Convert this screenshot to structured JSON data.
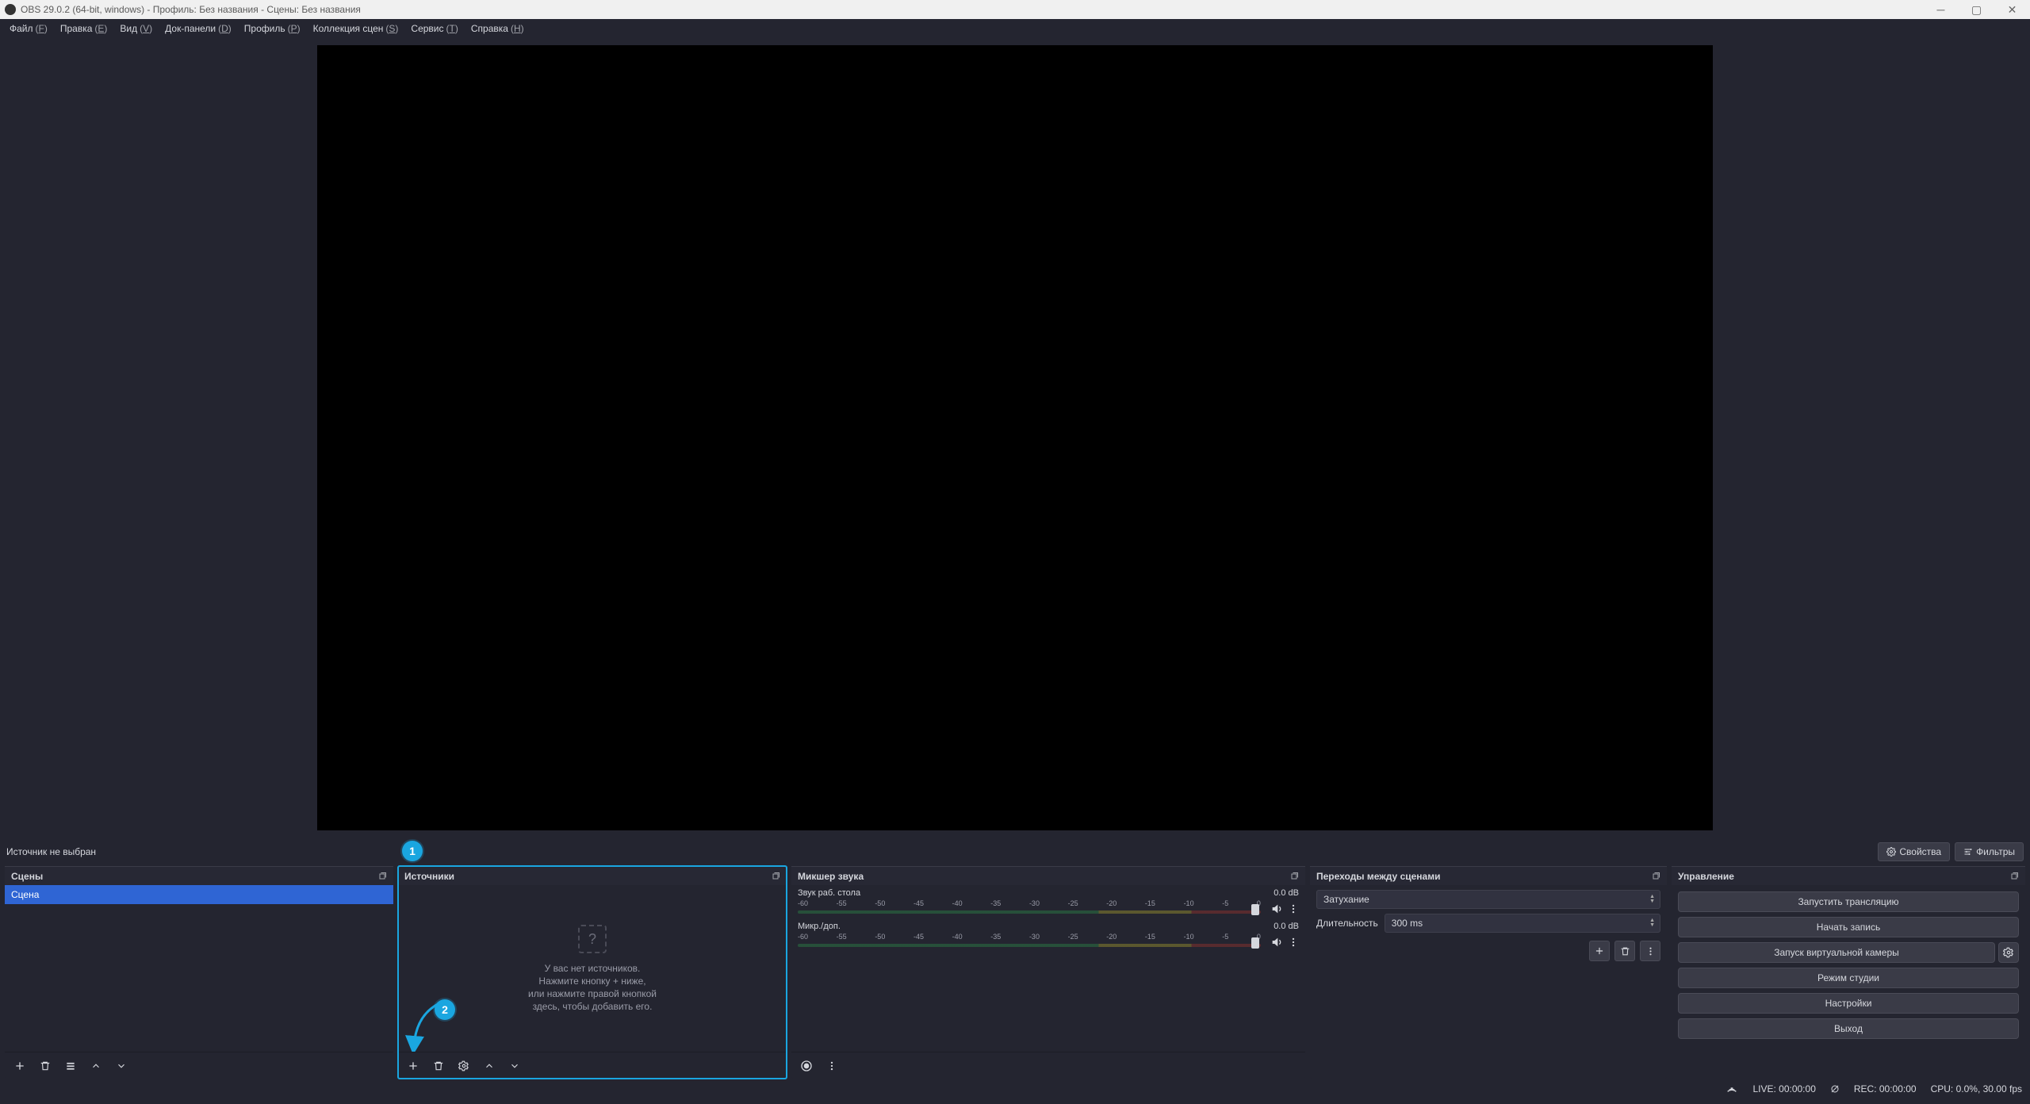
{
  "titlebar": {
    "text": "OBS 29.0.2 (64-bit, windows) - Профиль: Без названия - Сцены: Без названия"
  },
  "menus": [
    {
      "label": "Файл",
      "accel": "F"
    },
    {
      "label": "Правка",
      "accel": "E"
    },
    {
      "label": "Вид",
      "accel": "V"
    },
    {
      "label": "Док-панели",
      "accel": "D"
    },
    {
      "label": "Профиль",
      "accel": "P"
    },
    {
      "label": "Коллекция сцен",
      "accel": "S"
    },
    {
      "label": "Сервис",
      "accel": "T"
    },
    {
      "label": "Справка",
      "accel": "H"
    }
  ],
  "source_toolbar": {
    "status": "Источник не выбран",
    "props": "Свойства",
    "filters": "Фильтры"
  },
  "callouts": {
    "b1": "1",
    "b2": "2"
  },
  "scenes": {
    "title": "Сцены",
    "items": [
      "Сцена"
    ]
  },
  "sources": {
    "title": "Источники",
    "empty_l1": "У вас нет источников.",
    "empty_l2": "Нажмите кнопку + ниже,",
    "empty_l3": "или нажмите правой кнопкой",
    "empty_l4": "здесь, чтобы добавить его."
  },
  "mixer": {
    "title": "Микшер звука",
    "ticks": [
      "-60",
      "-55",
      "-50",
      "-45",
      "-40",
      "-35",
      "-30",
      "-25",
      "-20",
      "-15",
      "-10",
      "-5",
      "0"
    ],
    "channels": [
      {
        "name": "Звук раб. стола",
        "db": "0.0 dB"
      },
      {
        "name": "Микр./доп.",
        "db": "0.0 dB"
      }
    ]
  },
  "transitions": {
    "title": "Переходы между сценами",
    "select": "Затухание",
    "dur_label": "Длительность",
    "dur_value": "300 ms"
  },
  "controls": {
    "title": "Управление",
    "btns": {
      "stream": "Запустить трансляцию",
      "record": "Начать запись",
      "vcam": "Запуск виртуальной камеры",
      "studio": "Режим студии",
      "settings": "Настройки",
      "exit": "Выход"
    }
  },
  "status": {
    "live": "LIVE: 00:00:00",
    "rec": "REC: 00:00:00",
    "cpu": "CPU: 0.0%, 30.00 fps"
  }
}
